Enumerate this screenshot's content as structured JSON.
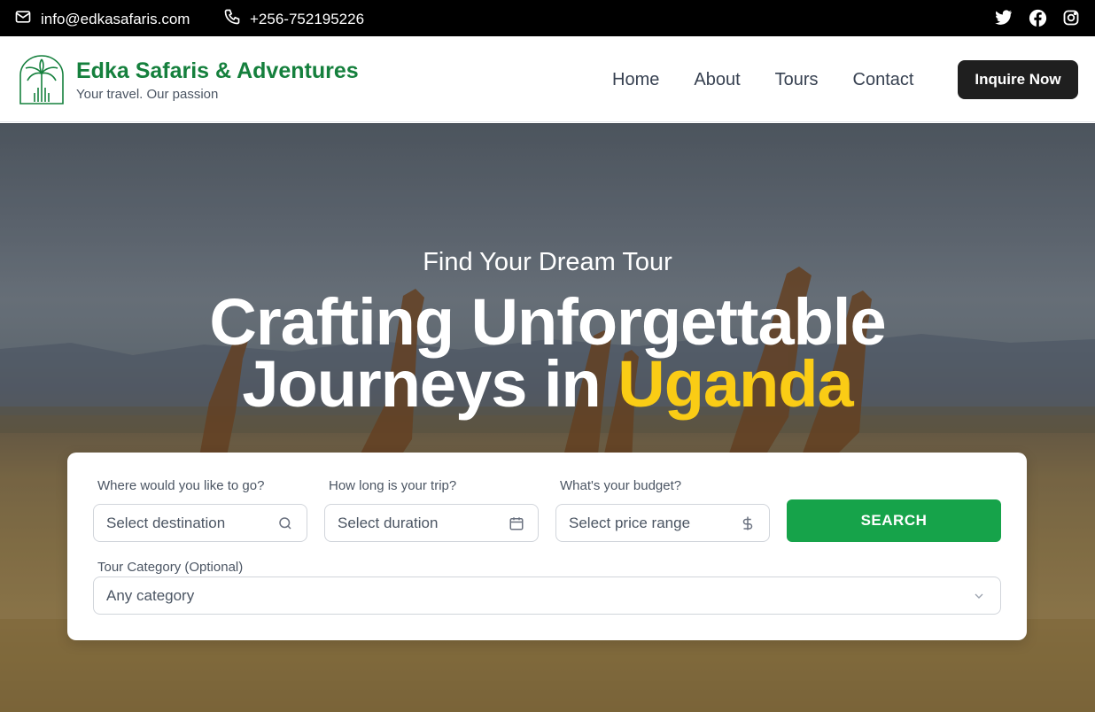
{
  "topbar": {
    "email": "info@edkasafaris.com",
    "phone": "+256-752195226",
    "social": [
      "twitter-icon",
      "facebook-icon",
      "instagram-icon"
    ]
  },
  "header": {
    "brand_name": "Edka Safaris & Adventures",
    "tagline": "Your travel. Our passion",
    "nav": [
      "Home",
      "About",
      "Tours",
      "Contact"
    ],
    "cta": "Inquire Now"
  },
  "hero": {
    "subtitle": "Find Your Dream Tour",
    "title_line1": "Crafting Unforgettable",
    "title_line2_prefix": "Journeys in ",
    "title_line2_accent": "Uganda"
  },
  "search": {
    "destination_label": "Where would you like to go?",
    "destination_placeholder": "Select destination",
    "duration_label": "How long is your trip?",
    "duration_placeholder": "Select duration",
    "budget_label": "What's your budget?",
    "budget_placeholder": "Select price range",
    "search_button": "SEARCH",
    "category_label": "Tour Category (Optional)",
    "category_value": "Any category"
  },
  "colors": {
    "brand_green": "#15803d",
    "accent_yellow": "#facc15",
    "search_green": "#16a34a",
    "topbar": "#000000"
  }
}
